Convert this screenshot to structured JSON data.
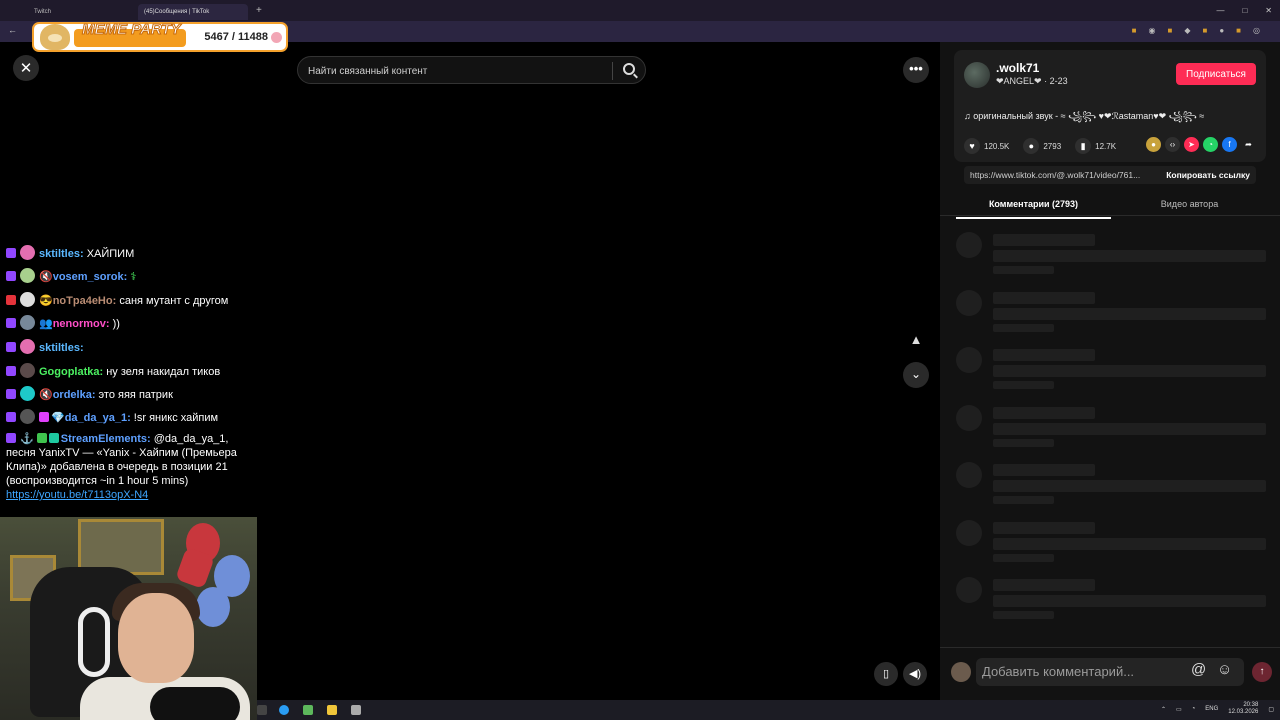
{
  "browser": {
    "tabs": [
      {
        "label": "Twitch",
        "active": false
      },
      {
        "label": "(45)Сообщения | TikTok",
        "active": true
      }
    ],
    "new_tab": "+",
    "window_controls": [
      "—",
      "□",
      "✕"
    ],
    "back": "←"
  },
  "meme_party": {
    "title": "MEME PARTY",
    "score": "5467 / 11488"
  },
  "viewer": {
    "close_icon": "✕",
    "search_placeholder": "Найти связанный контент",
    "more_icon": "•••",
    "nav_up_icon": "▲",
    "nav_down_icon": "⌄",
    "mini_icon": "▯",
    "volume_icon": "◀)"
  },
  "chat": {
    "messages": [
      {
        "user": "sktiltles:",
        "text": " ХАЙПИМ",
        "color": "#5bb8ff",
        "platform": "twitch"
      },
      {
        "user": "vosem_sorok:",
        "text": " ⚕",
        "color": "#5ea0ff",
        "platform": "twitch"
      },
      {
        "user": "noTpa4eHo:",
        "text": " саня мутант с другом",
        "color": "#b98c73",
        "platform": "youtube"
      },
      {
        "user": "nenormov:",
        "text": " ))",
        "color": "#ff4fc8",
        "platform": "twitch"
      },
      {
        "user": "sktiltles:",
        "text": "",
        "color": "#5bb8ff",
        "platform": "twitch"
      },
      {
        "user": "Gogoplatka:",
        "text": " ну зеля накидал тиков",
        "color": "#4cf061",
        "platform": "twitch"
      },
      {
        "user": "ordelka:",
        "text": " это яяя патрик",
        "color": "#5ea0ff",
        "platform": "twitch"
      },
      {
        "user": "da_da_ya_1:",
        "text": " !sr яникс хайпим",
        "color": "#5ea0ff",
        "platform": "twitch"
      }
    ],
    "stream_elements": {
      "user": "StreamElements:",
      "text": " @da_da_ya_1, песня YanixTV — «Yanix - Хайпим (Премьера Клипа)» добавлена в очередь в позиции 21 (воспроизводится ~in 1 hour 5 mins)",
      "link": "https://youtu.be/t7113opX-N4",
      "color": "#5ea0ff"
    }
  },
  "panel": {
    "author": ".wolk71",
    "subline": "❤ANGEL❤ · 2-23",
    "follow_label": "Подписаться",
    "sound": "♫  оригинальный звук - ≈ ꧁꧂ ♥❤ℛastaman♥❤ ꧁꧂ ≈",
    "likes": "120.5K",
    "comments": "2793",
    "saves": "12.7K",
    "url": "https://www.tiktok.com/@.wolk71/video/761...",
    "copy_label": "Копировать ссылку",
    "tab_comments": "Комментарии (2793)",
    "tab_videos": "Видео автора",
    "comment_placeholder": "Добавить комментарий...",
    "at_icon": "@",
    "emoji_icon": "☺",
    "post_icon": "↑"
  },
  "taskbar": {
    "lang": "ENG",
    "time": "20:38",
    "date": "12.03.2026"
  },
  "colors": {
    "accent": "#fe2c55",
    "twitch": "#9147ff",
    "meme_orange": "#f39c1f"
  }
}
